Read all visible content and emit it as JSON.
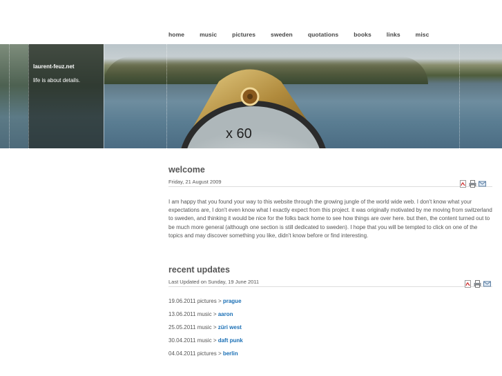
{
  "nav": [
    "home",
    "music",
    "pictures",
    "sweden",
    "quotations",
    "books",
    "links",
    "misc"
  ],
  "site": {
    "title": "laurent-feuz.net",
    "tagline": "life is about details."
  },
  "dial": {
    "label": "x 60"
  },
  "welcome": {
    "title": "welcome",
    "date": "Friday, 21 August 2009",
    "text": "I am happy that you found your way to this website through the growing jungle of the world wide web. I don't know what your expectations are, I don't even know what I exactly expect from this project. it was originally motivated by me moving from switzerland to sweden, and thinking it would be nice for the folks back home to see how things are over here. but then, the content turned out to be much more general (although one section is still dedicated to sweden). I hope that you will be tempted to click on one of the topics and may discover something you like, didn't know before or find interesting."
  },
  "updates": {
    "title": "recent updates",
    "date": "Last Updated on Sunday, 19 June 2011",
    "items": [
      {
        "date": "19.06.2011",
        "section": "pictures",
        "sep": ">",
        "link": "prague"
      },
      {
        "date": "13.06.2011",
        "section": "music",
        "sep": ">",
        "link": "aaron"
      },
      {
        "date": "25.05.2011",
        "section": "music",
        "sep": ">",
        "link": "züri west"
      },
      {
        "date": "30.04.2011",
        "section": "music",
        "sep": ">",
        "link": "daft punk"
      },
      {
        "date": "04.04.2011",
        "section": "pictures",
        "sep": ">",
        "link": "berlin"
      }
    ]
  },
  "icons": {
    "pdf": "pdf-icon",
    "print": "print-icon",
    "email": "email-icon"
  },
  "colors": {
    "link": "#1a6fb5",
    "text": "#555555"
  }
}
